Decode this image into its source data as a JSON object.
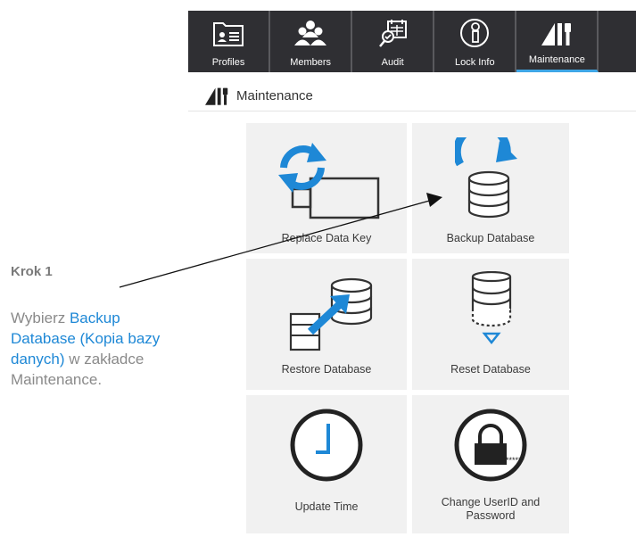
{
  "tabs": [
    {
      "label": "Profiles",
      "icon": "profiles-icon"
    },
    {
      "label": "Members",
      "icon": "members-icon"
    },
    {
      "label": "Audit",
      "icon": "audit-icon"
    },
    {
      "label": "Lock Info",
      "icon": "lock-info-icon"
    },
    {
      "label": "Maintenance",
      "icon": "maintenance-icon"
    }
  ],
  "active_tab": "Maintenance",
  "subheader": {
    "title": "Maintenance"
  },
  "tiles": [
    {
      "label": "Replace Data Key",
      "icon": "replace-data-key-icon"
    },
    {
      "label": "Backup Database",
      "icon": "backup-database-icon"
    },
    {
      "label": "Restore Database",
      "icon": "restore-database-icon"
    },
    {
      "label": "Reset Database",
      "icon": "reset-database-icon"
    },
    {
      "label": "Update Time",
      "icon": "clock-icon"
    },
    {
      "label_line1": "Change UserID and",
      "label_line2": "Password",
      "password_mask": "******",
      "icon": "padlock-icon"
    }
  ],
  "instructions": {
    "step": "Krok 1",
    "text_before": "Wybierz ",
    "highlight": "Backup Database (Kopia bazy danych)",
    "text_after": " w zakładce Maintenance."
  },
  "colors": {
    "tabbar": "#2f2f33",
    "accent": "#1e88d6",
    "active_underline": "#3ea6e6",
    "tile": "#f1f1f1"
  }
}
